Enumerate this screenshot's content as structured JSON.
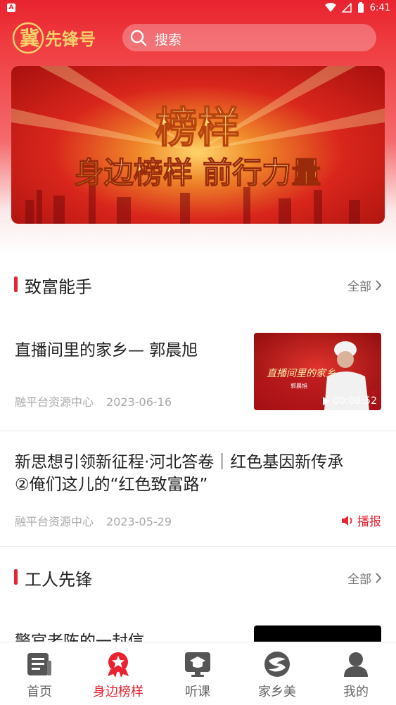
{
  "status_bar": {
    "time": "6:41",
    "notification_label": "A"
  },
  "header": {
    "logo_text": "冀先锋号",
    "search_placeholder": "搜索"
  },
  "banner": {
    "title": "榜样",
    "subtitle": "身边榜样 前行力量"
  },
  "sections": [
    {
      "title": "致富能手",
      "more_label": "全部",
      "articles": [
        {
          "title": "直播间里的家乡— 郭晨旭",
          "source": "融平台资源中心",
          "date": "2023-06-16",
          "thumb_text": "直播间里的家乡",
          "thumb_sub": "郭晨旭",
          "duration": "00:08:52"
        },
        {
          "title_line1": "新思想引领新征程·河北答卷｜红色基因新传承",
          "title_line2": "②俺们这儿的“红色致富路”",
          "source": "融平台资源中心",
          "date": "2023-05-29",
          "action": "播报"
        }
      ]
    },
    {
      "title": "工人先锋",
      "more_label": "全部",
      "articles": [
        {
          "title": "警官老陈的一封信"
        }
      ]
    }
  ],
  "tabbar": {
    "items": [
      {
        "label": "首页",
        "icon": "news-icon"
      },
      {
        "label": "身边榜样",
        "icon": "medal-icon"
      },
      {
        "label": "听课",
        "icon": "lecture-icon"
      },
      {
        "label": "家乡美",
        "icon": "hometown-icon"
      },
      {
        "label": "我的",
        "icon": "profile-icon"
      }
    ],
    "active_index": 1
  },
  "colors": {
    "brand_red": "#e8232f",
    "meta_gray": "#a9a9a9"
  }
}
